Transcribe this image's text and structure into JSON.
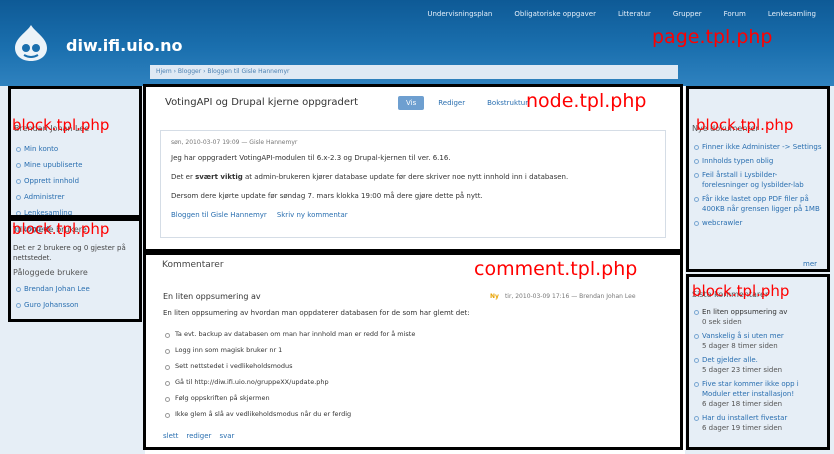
{
  "site": {
    "name": "diw.ifi.uio.no"
  },
  "primary_links": [
    "Undervisningsplan",
    "Obligatoriske oppgaver",
    "Litteratur",
    "Grupper",
    "Forum",
    "Lenkesamling"
  ],
  "labels": {
    "page": "page.tpl.php",
    "node": "node.tpl.php",
    "comment": "comment.tpl.php",
    "block": "block.tpl.php"
  },
  "breadcrumb": "Hjem › Blogger › Bloggen til Gisle Hannemyr",
  "user_block": {
    "title": "Brendan Johan Lee",
    "items": [
      "Min konto",
      "Mine upubliserte",
      "Opprett innhold",
      "Administrer",
      "Lenkesamling",
      "Logg ut"
    ]
  },
  "online_block": {
    "title": "Tilkoblede brukere",
    "text": "Det er 2 brukere og 0 gjester på nettstedet.",
    "subtitle": "Påloggede brukere",
    "users": [
      "Brendan Johan Lee",
      "Guro Johansson"
    ]
  },
  "node": {
    "title": "VotingAPI og Drupal kjerne oppgradert",
    "tabs": [
      "Vis",
      "Rediger",
      "Bokstruktur"
    ],
    "meta": "søn, 2010-03-07 19:09 — Gisle Hannemyr",
    "p1": "Jeg har oppgradert VotingAPI-modulen til 6.x-2.3 og Drupal-kjernen til ver. 6.16.",
    "p2_a": "Det er ",
    "p2_b": "svært viktig",
    "p2_c": " at admin-brukeren kjører database update før dere skriver noe nytt innhold inn i databasen.",
    "p3": "Dersom dere kjørte update før søndag 7. mars klokka 19:00 må dere gjøre dette på nytt.",
    "links": [
      "Bloggen til Gisle Hannemyr",
      "Skriv ny kommentar"
    ]
  },
  "comments": {
    "heading": "Kommentarer",
    "title": "En liten oppsumering av",
    "new": "Ny",
    "meta": "tir, 2010-03-09 17:16 — Brendan Johan Lee",
    "intro": "En liten oppsumering av hvordan man oppdaterer databasen for de som har glemt det:",
    "items": [
      "Ta evt. backup av databasen om man har innhold man er redd for å miste",
      "Logg inn som magisk bruker nr 1",
      "Sett nettstedet i vedlikeholdsmodus",
      "Gå til http://diw.ifi.uio.no/gruppeXX/update.php",
      "Følg oppskriften på skjermen",
      "Ikke glem å slå av vedlikeholdsmodus når du er ferdig"
    ],
    "links": [
      "slett",
      "rediger",
      "svar"
    ]
  },
  "new_docs_block": {
    "title": "Nye dokumenter",
    "items": [
      "Finner ikke Administer -> Settings",
      "Innholds typen oblig",
      "Feil årstall i Lysbilder-forelesninger og lysbilder-lab",
      "Får ikke lastet opp PDF filer på 400KB når grensen ligger på 1MB",
      "webcrawler"
    ],
    "more": "mer"
  },
  "latest_block": {
    "title": "Siste kommentarer",
    "items": [
      {
        "title": "En liten oppsumering av",
        "age": "0 sek siden"
      },
      {
        "title": "Vanskelig å si uten mer",
        "age": "5 dager 8 timer siden"
      },
      {
        "title": "Det gjelder alle.",
        "age": "5 dager 23 timer siden"
      },
      {
        "title": "Five star kommer ikke opp i Moduler etter installasjon!",
        "age": "6 dager 18 timer siden"
      },
      {
        "title": "Har du installert fivestar",
        "age": "6 dager 19 timer siden"
      }
    ]
  }
}
